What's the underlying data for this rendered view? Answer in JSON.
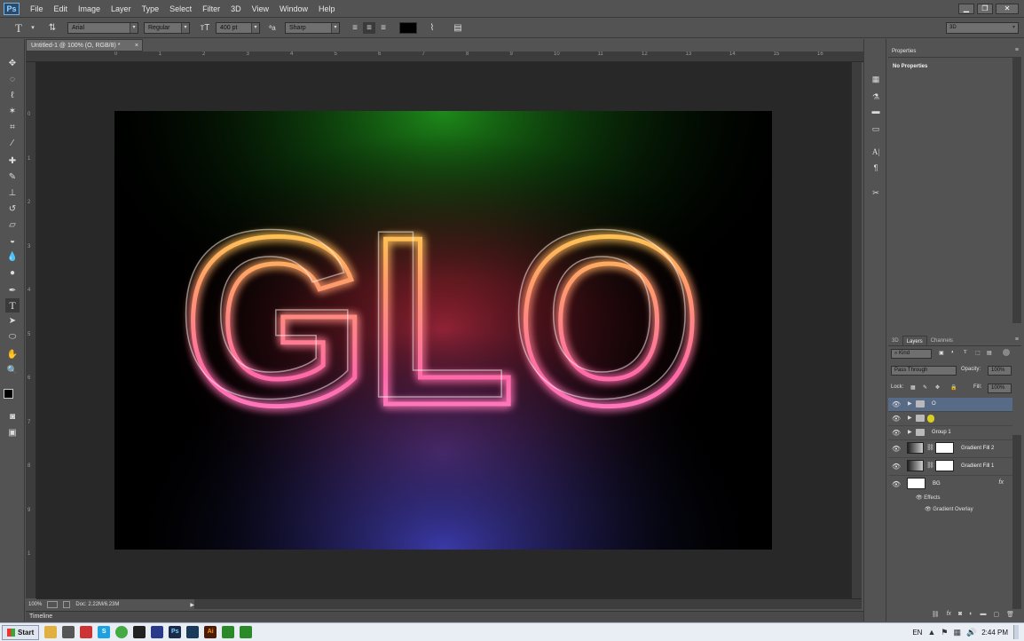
{
  "app": {
    "logo": "Ps",
    "menus": [
      "File",
      "Edit",
      "Image",
      "Layer",
      "Type",
      "Select",
      "Filter",
      "3D",
      "View",
      "Window",
      "Help"
    ],
    "window_buttons": {
      "minimize": "▁",
      "maximize": "❐",
      "close": "✕"
    }
  },
  "options": {
    "tool_icon": "T",
    "font_family": "Arial",
    "font_style": "Regular",
    "font_size": "400 pt",
    "antialias": "Sharp",
    "text_color": "#000000",
    "workspace": "3D"
  },
  "document": {
    "tab_title": "Untitled-1 @ 100% (O, RGB/8) *",
    "ruler_top": [
      "0",
      "1",
      "2",
      "3",
      "4",
      "5",
      "6",
      "7",
      "8",
      "9",
      "10",
      "11",
      "12",
      "13",
      "14",
      "15",
      "16"
    ],
    "ruler_left": [
      "0",
      "1",
      "2",
      "3",
      "4",
      "5",
      "6",
      "7",
      "8",
      "9",
      "1"
    ],
    "artwork_text": "GLO",
    "zoom": "100%",
    "doc_size": "Doc: 2.22M/6.23M",
    "timeline_label": "Timeline"
  },
  "properties": {
    "tab_label": "Properties",
    "empty_text": "No Properties"
  },
  "layers": {
    "tabs": [
      "3D",
      "Layers",
      "Channels"
    ],
    "filter_kind": "Kind",
    "blend_mode": "Pass Through",
    "opacity_label": "Opacity:",
    "opacity_value": "100%",
    "lock_label": "Lock:",
    "fill_label": "Fill:",
    "fill_value": "100%",
    "items": [
      {
        "name": "O",
        "type": "group"
      },
      {
        "name": "",
        "type": "group"
      },
      {
        "name": "Group 1",
        "type": "group"
      },
      {
        "name": "Gradient Fill 2",
        "type": "fill"
      },
      {
        "name": "Gradient Fill 1",
        "type": "fill"
      },
      {
        "name": "BG",
        "type": "layer"
      }
    ],
    "effects_label": "Effects",
    "effect_item": "Gradient Overlay",
    "fx_badge": "fx"
  },
  "taskbar": {
    "start_label": "Start",
    "language": "EN",
    "time": "2:44 PM"
  },
  "colors": {
    "selected_layer": "#576a86",
    "panel_bg": "#535353",
    "canvas_bg": "#282828"
  }
}
